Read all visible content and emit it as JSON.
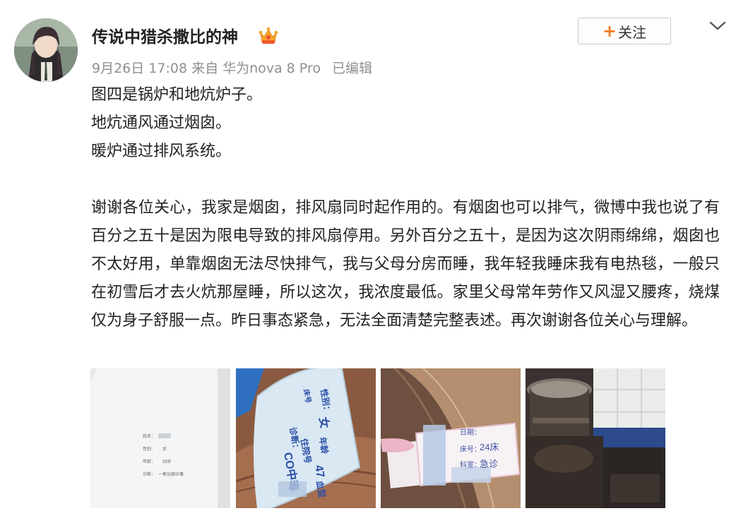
{
  "post": {
    "username": "传说中猎杀撒比的神",
    "meta": {
      "date": "9月26日 17:08",
      "source_prefix": "来自",
      "device": "华为nova 8 Pro",
      "edited": "已编辑"
    },
    "follow_plus": "+",
    "follow_label": "关注",
    "content": {
      "lines": [
        "图四是锅炉和地炕炉子。",
        "地炕通风通过烟囱。",
        "暖炉通过排风系统。"
      ],
      "paragraph": "谢谢各位关心，我家是烟囱，排风扇同时起作用的。有烟囱也可以排气，微博中我也说了有百分之五十是因为限电导致的排风扇停用。另外百分之五十，是因为这次阴雨绵绵，烟囱也不太好用，单靠烟囱无法尽快排气，我与父母分房而睡，我年轻我睡床我有电热毯，一般只在初雪后才去火炕那屋睡，所以这次，我浓度最低。家里父母常年劳作又风湿又腰疼，烧煤仅为身子舒服一点。昨日事态紧急，无法全面清楚完整表述。再次谢谢各位关心与理解。"
    },
    "images": {
      "photo1": {
        "label_name": "姓名：",
        "label_sex": "性别：",
        "sex": "女",
        "label_age": "年龄：",
        "age": "39岁",
        "label_diag": "诊断：",
        "diag": "一氧化碳中毒"
      },
      "photo2": {
        "sex_label": "性别：",
        "sex": "女",
        "bed_label": "床号",
        "age_label": "年龄",
        "age": "47",
        "blood_label": "血型",
        "diag_label": "诊断：",
        "diag": "CO中毒",
        "inpatient_label": "住院号"
      },
      "photo3": {
        "date_label": "日期：",
        "bed_label": "床号：",
        "bed": "24床",
        "dept_label": "科室：",
        "dept": "急诊"
      }
    }
  },
  "colors": {
    "accent": "#f57b24",
    "meta_text": "#8f8f8f"
  },
  "icons": {
    "vip": "crown-badge-icon",
    "dropdown": "chevron-down-icon"
  }
}
